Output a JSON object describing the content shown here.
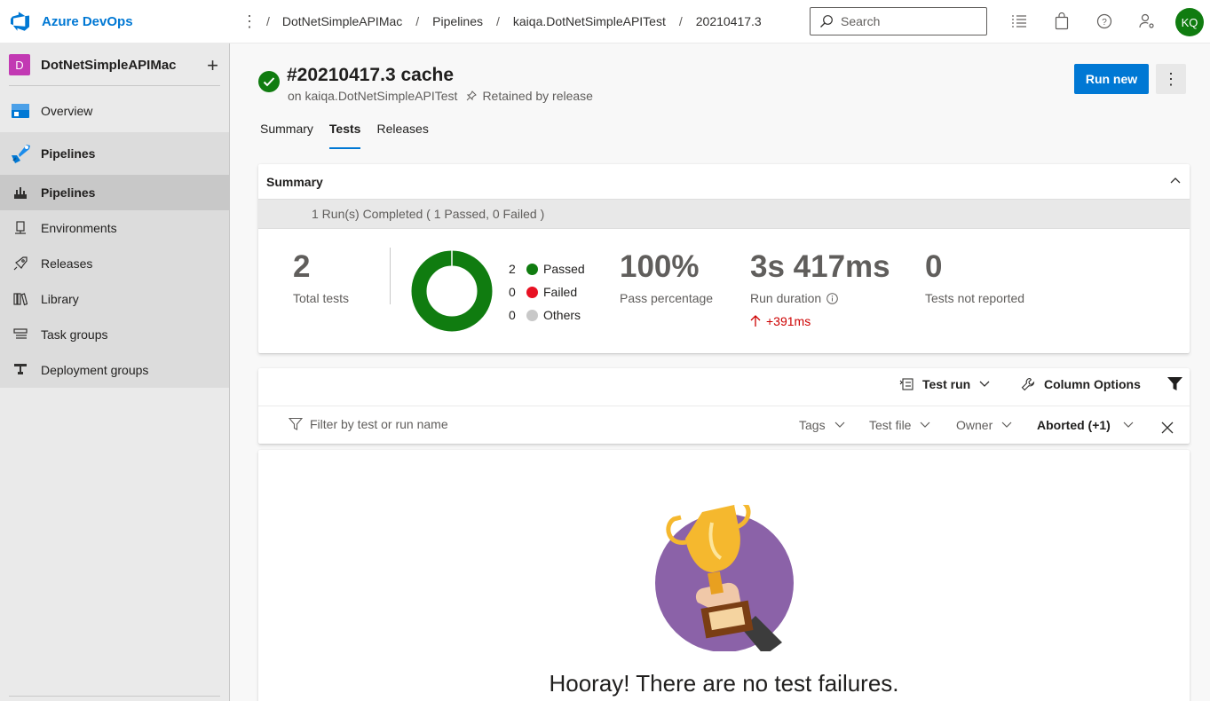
{
  "app": {
    "name": "Azure DevOps"
  },
  "breadcrumb": [
    "DotNetSimpleAPIMac",
    "Pipelines",
    "kaiqa.DotNetSimpleAPITest",
    "20210417.3"
  ],
  "search": {
    "placeholder": "Search"
  },
  "user": {
    "initials": "KQ"
  },
  "project": {
    "badge": "D",
    "name": "DotNetSimpleAPIMac"
  },
  "sidebar": {
    "items": [
      {
        "label": "Overview",
        "icon": "overview-icon"
      },
      {
        "label": "Pipelines",
        "icon": "pipelines-icon"
      },
      {
        "label": "Pipelines",
        "icon": "pipelines-sub-icon"
      },
      {
        "label": "Environments",
        "icon": "environments-icon"
      },
      {
        "label": "Releases",
        "icon": "releases-icon"
      },
      {
        "label": "Library",
        "icon": "library-icon"
      },
      {
        "label": "Task groups",
        "icon": "task-groups-icon"
      },
      {
        "label": "Deployment groups",
        "icon": "deployment-groups-icon"
      }
    ]
  },
  "run": {
    "title": "#20210417.3 cache",
    "pipeline": "on kaiqa.DotNetSimpleAPITest",
    "retained": "Retained by release",
    "run_new": "Run new",
    "status": "succeeded"
  },
  "tabs": [
    {
      "label": "Summary",
      "active": false
    },
    {
      "label": "Tests",
      "active": true
    },
    {
      "label": "Releases",
      "active": false
    }
  ],
  "summary": {
    "title": "Summary",
    "runs_completed": "1 Run(s) Completed ( 1 Passed, 0 Failed )",
    "total_tests": {
      "value": "2",
      "label": "Total tests"
    },
    "outcomes": [
      {
        "count": "2",
        "label": "Passed",
        "color": "#107c10"
      },
      {
        "count": "0",
        "label": "Failed",
        "color": "#e81123"
      },
      {
        "count": "0",
        "label": "Others",
        "color": "#c8c8c8"
      }
    ],
    "pass_percentage": {
      "value": "100%",
      "label": "Pass percentage"
    },
    "run_duration": {
      "value": "3s 417ms",
      "label": "Run duration",
      "delta": "+391ms"
    },
    "not_reported": {
      "value": "0",
      "label": "Tests not reported"
    }
  },
  "toolbar": {
    "group_by": "Test run",
    "column_options": "Column Options"
  },
  "filters": {
    "placeholder": "Filter by test or run name",
    "tags": "Tags",
    "test_file": "Test file",
    "owner": "Owner",
    "outcome": "Aborted (+1)"
  },
  "empty_state": {
    "message": "Hooray! There are no test failures."
  },
  "colors": {
    "accent": "#0078d4",
    "success": "#107c10",
    "danger": "#cd0000",
    "project_badge": "#c239b3"
  }
}
